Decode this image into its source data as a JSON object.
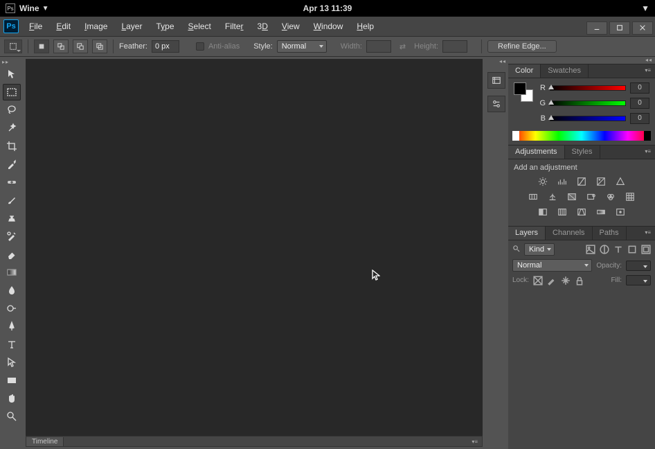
{
  "os": {
    "app_badge": "Ps",
    "app_name": "Wine",
    "clock": "Apr 13  11:39"
  },
  "menu": [
    "File",
    "Edit",
    "Image",
    "Layer",
    "Type",
    "Select",
    "Filter",
    "3D",
    "View",
    "Window",
    "Help"
  ],
  "window": {
    "minimize": "_",
    "maximize": "❐",
    "close": "✕"
  },
  "options": {
    "feather_label": "Feather:",
    "feather_value": "0 px",
    "antialias_label": "Anti-alias",
    "style_label": "Style:",
    "style_value": "Normal",
    "width_label": "Width:",
    "height_label": "Height:",
    "refine_label": "Refine Edge..."
  },
  "timeline_tab": "Timeline",
  "panels": {
    "color": {
      "tab_color": "Color",
      "tab_swatches": "Swatches",
      "r_label": "R",
      "r_value": "0",
      "g_label": "G",
      "g_value": "0",
      "b_label": "B",
      "b_value": "0"
    },
    "adjustments": {
      "tab_adjustments": "Adjustments",
      "tab_styles": "Styles",
      "hint": "Add an adjustment"
    },
    "layers": {
      "tab_layers": "Layers",
      "tab_channels": "Channels",
      "tab_paths": "Paths",
      "kind_label": "Kind",
      "blend_value": "Normal",
      "opacity_label": "Opacity:",
      "lock_label": "Lock:",
      "fill_label": "Fill:"
    }
  }
}
